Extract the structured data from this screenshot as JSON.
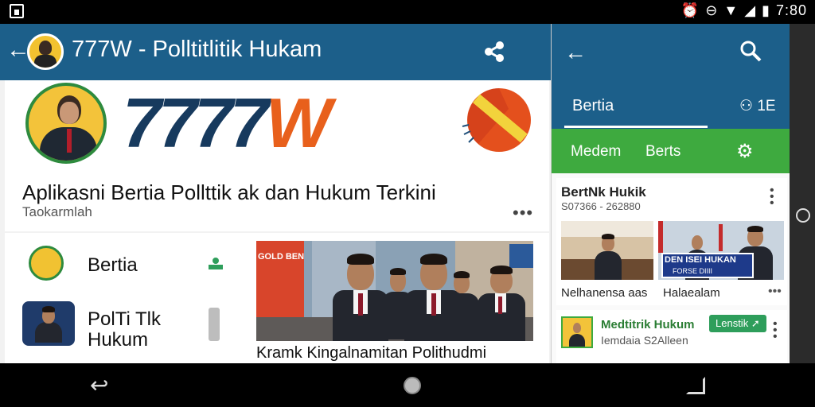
{
  "status_bar": {
    "time": "7:80"
  },
  "left_app": {
    "toolbar": {
      "title": "777W - Polltitlitik Hukam"
    },
    "hero": {
      "brand_text": "7777",
      "brand_accent": "W",
      "title": "Aplikasni Bertia Pollttik ak dan Hukum Terkini",
      "subtitle": "Taokarmlah",
      "more": "•••"
    },
    "side_list": [
      {
        "label": "Bertia"
      },
      {
        "label": "PolTi Tlk\nHukum"
      }
    ],
    "news": {
      "photo_banner": "GOLD BEN",
      "caption": "Kramk Kingalnamitan Polithudmi"
    }
  },
  "right_app": {
    "tabs": [
      "Bertia",
      "1E"
    ],
    "subtabs": [
      "Medem",
      "Berts"
    ],
    "card1": {
      "title": "BertNk Hukik",
      "subtitle": "S07366 - 262880",
      "captions": [
        "Nelhanensa aas",
        "Halaealam"
      ],
      "image_banner": "DEN ISEI HUKAN",
      "image_banner_sub": "FORSE DIIII"
    },
    "card2": {
      "title": "Medtitrik Hukum",
      "subtitle": "Iemdaia  S2Alleen",
      "button": "Lenstik"
    }
  },
  "colors": {
    "primary": "#1c5f8a",
    "green": "#3eaa3f",
    "brand_navy": "#173a5e",
    "brand_orange": "#e8601c",
    "logo_yellow": "#f3c33a"
  },
  "icons": [
    "share-icon",
    "search-icon",
    "back-arrow-icon",
    "people-icon",
    "gear-icon",
    "more-icon",
    "home-icon",
    "recents-icon"
  ]
}
